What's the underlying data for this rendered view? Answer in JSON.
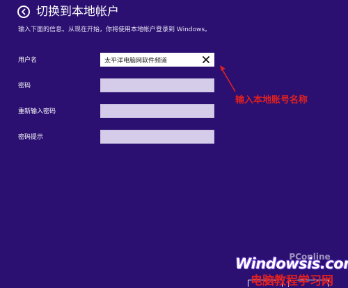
{
  "header": {
    "title": "切换到本地帐户",
    "subtitle": "输入下面的信息。从现在开始，你将使用本地帐户登录到 Windows。"
  },
  "form": {
    "username": {
      "label": "用户名",
      "value": "太平洋电脑网软件频道"
    },
    "password": {
      "label": "密码",
      "value": ""
    },
    "password_confirm": {
      "label": "重新输入密码",
      "value": ""
    },
    "password_hint": {
      "label": "密码提示",
      "value": ""
    }
  },
  "annotation": {
    "text": "输入本地账号名称",
    "color": "#e02020"
  },
  "watermark": {
    "logo": "PConline",
    "site": "Windowsis.com",
    "site_cn": "电脑教程学习网"
  },
  "icons": {
    "back": "back-arrow-icon",
    "clear": "close-icon",
    "annotation_arrow": "arrow-icon"
  },
  "colors": {
    "background": "#2b1071",
    "field": "#d4cce8",
    "annotation": "#e02020"
  }
}
